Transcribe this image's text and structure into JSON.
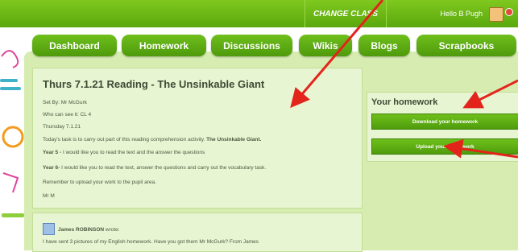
{
  "topbar": {
    "change_class": "CHANGE CLASS",
    "greeting": "Hello B Pugh"
  },
  "nav": [
    {
      "label": "Dashboard"
    },
    {
      "label": "Homework"
    },
    {
      "label": "Discussions"
    },
    {
      "label": "Wikis"
    },
    {
      "label": "Blogs"
    },
    {
      "label": "Scrapbooks"
    }
  ],
  "post": {
    "title": "Thurs 7.1.21 Reading - The Unsinkable Giant",
    "set_by": "Set By: Mr McGurk",
    "who": "Who can see it: CL 4",
    "date": "Thursday 7.1.21",
    "task_text": "Today's task is to carry out part of this reading comprehension activity.",
    "task_bold": "The Unsinkable Giant.",
    "year5_label": "Year 5 -",
    "year5_text": "I would like you to read the text and the answer the questions",
    "year6_label": "Year 6-",
    "year6_text": "I would like you to read the text, answer the questions and carry out the vocabulary task.",
    "reminder": "Remember to upload your work to the pupil area.",
    "signoff": "Mr M"
  },
  "sidebar": {
    "title": "Your homework",
    "download_label": "Download your homework",
    "upload_label": "Upload your homework"
  },
  "comment": {
    "author": "James ROBINSON",
    "wrote": "wrote:",
    "text": "I have sent 3 pictures of my English homework. Have you got them Mr McGurk? From James"
  },
  "colors": {
    "bar_green": "#5aa80d",
    "panel_green": "#d6ecb0",
    "arrow_red": "#e3241b"
  }
}
